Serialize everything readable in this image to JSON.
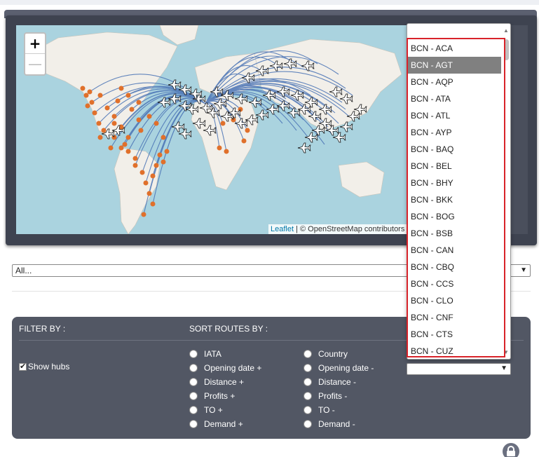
{
  "map": {
    "attribution_link": "Leaflet",
    "attribution_text": " | © OpenStreetMap contributors",
    "zoom_in": "+",
    "zoom_out": "—"
  },
  "filter_select": {
    "value": "All..."
  },
  "panel": {
    "filter_title": "FILTER BY :",
    "sort_title": "SORT ROUTES BY :",
    "show_hubs": "Show hubs",
    "radios_left": [
      "IATA",
      "Opening date +",
      "Distance +",
      "Profits +",
      "TO +",
      "Demand +"
    ],
    "radios_right": [
      "Country",
      "Opening date -",
      "Distance -",
      "Profits -",
      "TO -",
      "Demand -"
    ]
  },
  "routes_dropdown": {
    "selected": "BCN - AGT",
    "options": [
      "BCN - ACA",
      "BCN - AGT",
      "BCN - AQP",
      "BCN - ATA",
      "BCN - ATL",
      "BCN - AYP",
      "BCN - BAQ",
      "BCN - BEL",
      "BCN - BHY",
      "BCN - BKK",
      "BCN - BOG",
      "BCN - BSB",
      "BCN - CAN",
      "BCN - CBQ",
      "BCN - CCS",
      "BCN - CLO",
      "BCN - CNF",
      "BCN - CTS",
      "BCN - CUZ"
    ]
  },
  "colors": {
    "route": "#4a73b5",
    "airport": "#e0702b",
    "selected_option": "#808080",
    "highlight_box": "#d8232a",
    "panel": "#525764"
  },
  "icons": {
    "zoom_in": "plus-icon",
    "zoom_out": "minus-icon",
    "plane": "plane-icon",
    "lock": "lock-icon"
  }
}
